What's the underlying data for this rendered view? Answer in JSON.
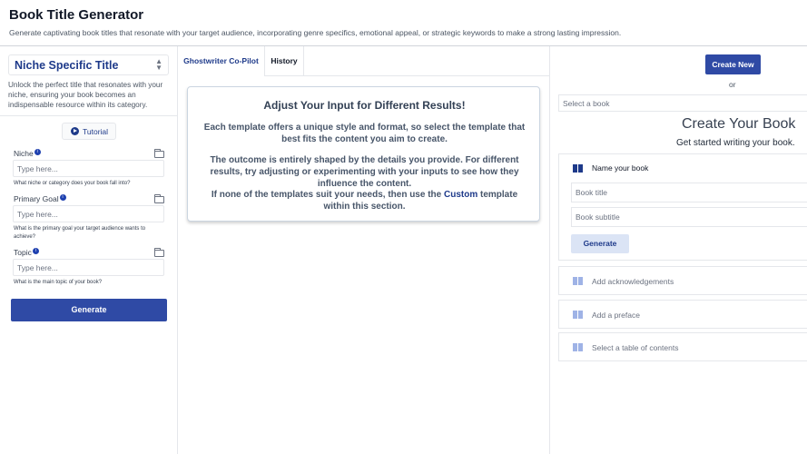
{
  "header": {
    "title": "Book Title Generator",
    "subtitle": "Generate captivating book titles that resonate with your target audience, incorporating genre specifics, emotional appeal, or strategic keywords to make a strong lasting impression."
  },
  "left_panel": {
    "template_select": {
      "value": "Niche Specific Title"
    },
    "template_description": "Unlock the perfect title that resonates with your niche, ensuring your book becomes an indispensable resource within its category.",
    "tutorial_label": "Tutorial",
    "fields": [
      {
        "label": "Niche",
        "placeholder": "Type here...",
        "help": "What niche or category does your book fall into?"
      },
      {
        "label": "Primary Goal",
        "placeholder": "Type here...",
        "help": "What is the primary goal your target audience wants to achieve?"
      },
      {
        "label": "Topic",
        "placeholder": "Type here...",
        "help": "What is the main topic of your book?"
      }
    ],
    "generate_label": "Generate"
  },
  "tabs": [
    {
      "label": "Ghostwriter Co-Pilot",
      "active": true
    },
    {
      "label": "History",
      "active": false
    }
  ],
  "info_card": {
    "title": "Adjust Your Input for Different Results!",
    "para1": "Each template offers a unique style and format, so select the template that best fits the content you aim to create.",
    "para2": "The outcome is entirely shaped by the details you provide. For different results, try adjusting or experimenting with your inputs to see how they influence the content.",
    "para3_before": "If none of the templates suit your needs, then use the ",
    "para3_custom": "Custom",
    "para3_after": " template within this section."
  },
  "right_panel": {
    "create_new_label": "Create New",
    "or_text": "or",
    "select_book_placeholder": "Select a book",
    "create_title": "Create Your Book",
    "create_subtitle": "Get started writing your book.",
    "name_book_label": "Name your book",
    "book_title_placeholder": "Book title",
    "book_subtitle_placeholder": "Book subtitle",
    "generate_label": "Generate",
    "options": [
      {
        "label": "Add acknowledgements"
      },
      {
        "label": "Add a preface"
      },
      {
        "label": "Select a table of contents"
      }
    ]
  },
  "colors": {
    "primary": "#2f4aa5",
    "accent_text": "#1e3a8a",
    "light_button": "#dbe4f5",
    "border": "#e5e7eb"
  },
  "icons": [
    "chevron-up-down-icon",
    "play-icon",
    "info-icon",
    "folder-icon",
    "book-icon"
  ]
}
